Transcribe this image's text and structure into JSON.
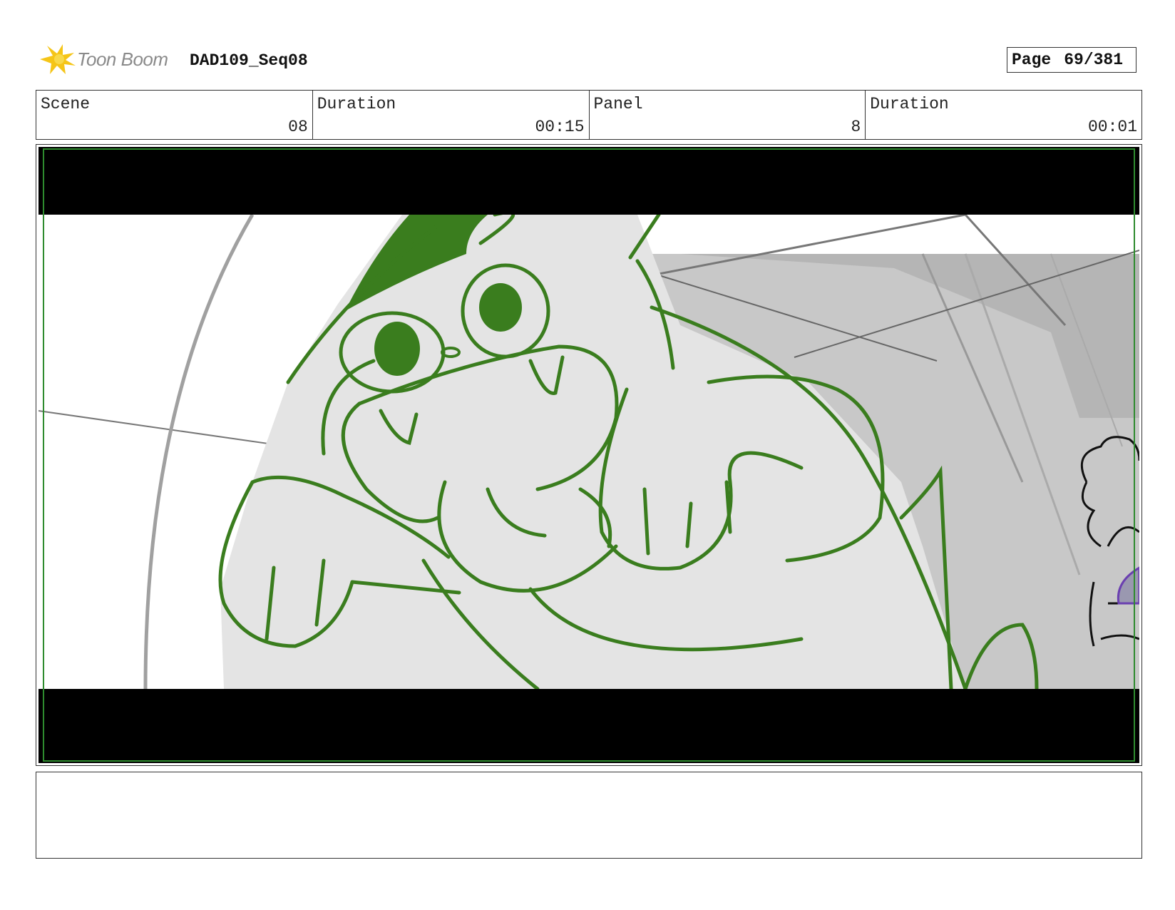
{
  "header": {
    "logo_text": "Toon Boom",
    "project": "DAD109_Seq08",
    "page_label": "Page",
    "page_value": "69/381"
  },
  "info": {
    "scene_label": "Scene",
    "scene_value": "08",
    "scene_duration_label": "Duration",
    "scene_duration_value": "00:15",
    "panel_label": "Panel",
    "panel_value": "8",
    "panel_duration_label": "Duration",
    "panel_duration_value": "00:01"
  },
  "notes": {
    "text": ""
  },
  "colors": {
    "sketch_green": "#3a7d1e",
    "letterbox": "#000000",
    "safe_frame": "#2e8b2e"
  }
}
